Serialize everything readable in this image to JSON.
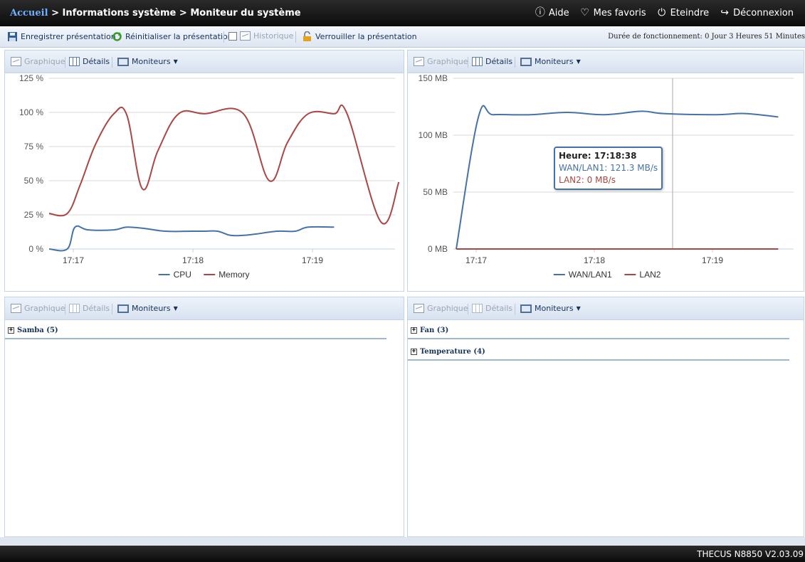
{
  "header": {
    "home": "Accueil",
    "sep": ">",
    "crumb1": "Informations système",
    "crumb2": "Moniteur du système",
    "nav": [
      {
        "label": "Aide",
        "icon": "help-icon"
      },
      {
        "label": "Mes favoris",
        "icon": "heart-icon"
      },
      {
        "label": "Eteindre",
        "icon": "power-icon"
      },
      {
        "label": "Déconnexion",
        "icon": "logout-icon"
      }
    ]
  },
  "toolbar": {
    "save": "Enregistrer présentation",
    "reset": "Réinitialiser la présentation",
    "history": "Historique",
    "lock": "Verrouiller la présentation",
    "uptime_label": "Durée de fonctionnement:",
    "uptime_value": "0 Jour 3 Heures 51 Minutes"
  },
  "panel_bar": {
    "graph": "Graphique",
    "details": "Détails",
    "monitors": "Moniteurs"
  },
  "chart_data": [
    {
      "type": "line",
      "yticks": [
        "125 %",
        "100 %",
        "75 %",
        "50 %",
        "25 %",
        "0 %"
      ],
      "ylim": [
        0,
        125
      ],
      "xticks": [
        "17:17",
        "17:18",
        "17:19"
      ],
      "grid": true,
      "legend_position": "bottom",
      "series": [
        {
          "name": "CPU",
          "color": "#4572a7",
          "points": [
            [
              0,
              0
            ],
            [
              0.07,
              0
            ],
            [
              0.1,
              16
            ],
            [
              0.15,
              14
            ],
            [
              0.25,
              14
            ],
            [
              0.3,
              16
            ],
            [
              0.37,
              15
            ],
            [
              0.45,
              13
            ],
            [
              0.55,
              13
            ],
            [
              0.6,
              13
            ],
            [
              0.65,
              13
            ],
            [
              0.7,
              10
            ],
            [
              0.75,
              10
            ],
            [
              0.8,
              11
            ],
            [
              0.88,
              13
            ],
            [
              0.95,
              13
            ],
            [
              1.0,
              16
            ],
            [
              1.1,
              16
            ]
          ]
        },
        {
          "name": "Memory",
          "color": "#aa4643",
          "points": [
            [
              0,
              26
            ],
            [
              0.07,
              26
            ],
            [
              0.12,
              47
            ],
            [
              0.18,
              77
            ],
            [
              0.25,
              99
            ],
            [
              0.3,
              98
            ],
            [
              0.36,
              44
            ],
            [
              0.42,
              72
            ],
            [
              0.5,
              99
            ],
            [
              0.6,
              99
            ],
            [
              0.75,
              99
            ],
            [
              0.85,
              50
            ],
            [
              0.92,
              78
            ],
            [
              1.0,
              99
            ],
            [
              1.1,
              99
            ],
            [
              1.15,
              99
            ],
            [
              1.28,
              20
            ],
            [
              1.35,
              49
            ]
          ]
        }
      ]
    },
    {
      "type": "line",
      "yticks": [
        "150 MB",
        "100 MB",
        "50 MB",
        "0 MB"
      ],
      "ylim": [
        0,
        150
      ],
      "xticks": [
        "17:17",
        "17:18",
        "17:19"
      ],
      "grid": true,
      "legend_position": "bottom",
      "series": [
        {
          "name": "WAN/LAN1",
          "color": "#4572a7",
          "points": [
            [
              0,
              0
            ],
            [
              0.3,
              116
            ],
            [
              0.5,
              118
            ],
            [
              1.0,
              118
            ],
            [
              1.5,
              120
            ],
            [
              2.0,
              118
            ],
            [
              2.5,
              121
            ],
            [
              2.8,
              119
            ],
            [
              3.5,
              118
            ],
            [
              3.9,
              119
            ],
            [
              4.35,
              116
            ]
          ]
        },
        {
          "name": "LAN2",
          "color": "#aa4643",
          "points": [
            [
              0,
              0
            ],
            [
              4.35,
              0
            ]
          ]
        }
      ],
      "tooltip": {
        "title": "Heure: 17:18:38",
        "line1": "WAN/LAN1: 121.3 MB/s",
        "line2": "LAN2: 0 MB/s"
      }
    }
  ],
  "trees": {
    "samba": "Samba (5)",
    "fan": "Fan (3)",
    "temperature": "Temperature (4)"
  },
  "footer": {
    "version": "THECUS N8850 V2.03.09"
  }
}
